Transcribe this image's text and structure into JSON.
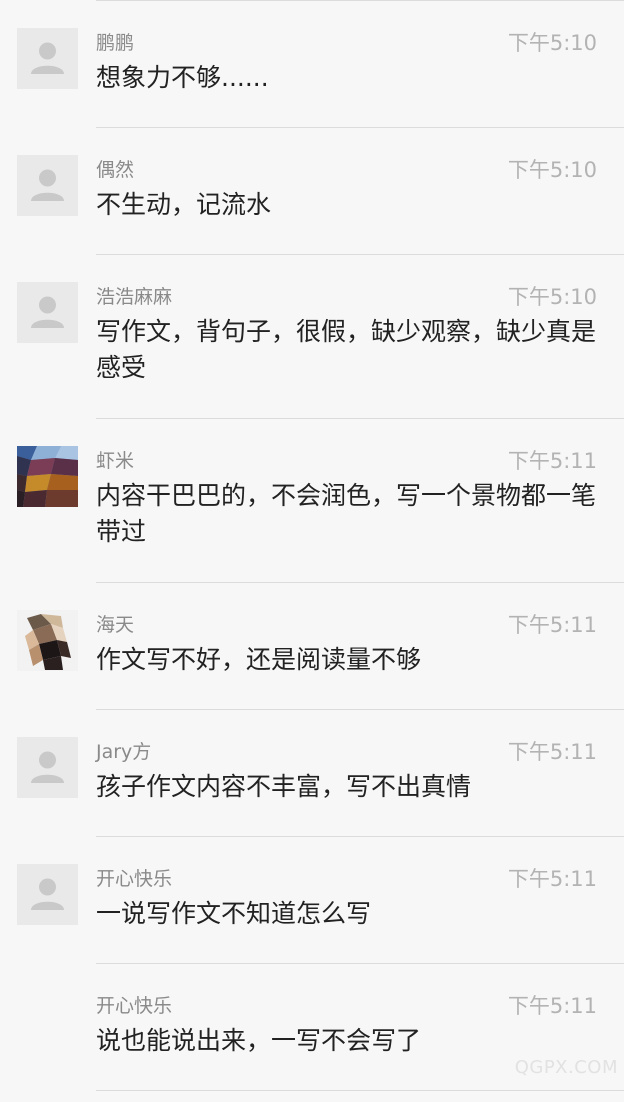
{
  "comments": [
    {
      "name": "鹏鹏",
      "time": "下午5:10",
      "text": "想象力不够......",
      "avatar": "default-avatar"
    },
    {
      "name": "偶然",
      "time": "下午5:10",
      "text": "不生动，记流水",
      "avatar": "default-avatar"
    },
    {
      "name": "浩浩麻麻",
      "time": "下午5:10",
      "text": "写作文，背句子，很假，缺少观察，缺少真是感受",
      "avatar": "default-avatar"
    },
    {
      "name": "虾米",
      "time": "下午5:11",
      "text": "内容干巴巴的，不会润色，写一个景物都一笔带过",
      "avatar": "mosaic-avatar"
    },
    {
      "name": "海天",
      "time": "下午5:11",
      "text": "作文写不好，还是阅读量不够",
      "avatar": "mosaic-avatar"
    },
    {
      "name": "Jary方",
      "time": "下午5:11",
      "text": "孩子作文内容不丰富，写不出真情",
      "avatar": "default-avatar"
    },
    {
      "name": "开心快乐",
      "time": "下午5:11",
      "text": "一说写作文不知道怎么写",
      "avatar": "default-avatar"
    },
    {
      "name": "开心快乐",
      "time": "下午5:11",
      "text": "说也能说出来，一写不会写了",
      "avatar": "none"
    }
  ],
  "watermark": "QGPX.COM",
  "colors": {
    "background": "#f7f7f7",
    "divider": "#dcdcdc",
    "name": "#8a8a8a",
    "time": "#b3b3b3",
    "text": "#222222",
    "avatar_placeholder": "#e9e9e9"
  }
}
